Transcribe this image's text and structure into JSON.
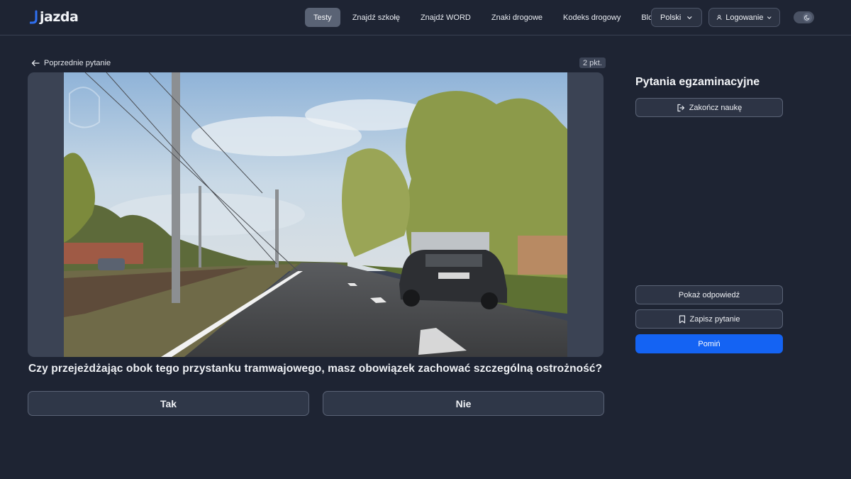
{
  "brand": {
    "name": "jazda"
  },
  "nav": {
    "items": [
      {
        "label": "Testy",
        "active": true
      },
      {
        "label": "Znajdź szkołę"
      },
      {
        "label": "Znajdź WORD"
      },
      {
        "label": "Znaki drogowe"
      },
      {
        "label": "Kodeks drogowy"
      },
      {
        "label": "Blog"
      }
    ],
    "language": "Polski",
    "login": "Logowanie",
    "theme_icon": "moon-icon"
  },
  "question_view": {
    "prev_label": "Poprzednie pytanie",
    "points": "2 pkt.",
    "question": "Czy przejeżdżając obok tego przystanku tramwajowego, masz obowiązek zachować szczególną ostrożność?",
    "answers": [
      "Tak",
      "Nie"
    ]
  },
  "sidebar": {
    "title": "Pytania egzaminacyjne",
    "finish_label": "Zakończ naukę",
    "show_answer_label": "Pokaż odpowiedź",
    "save_label": "Zapisz pytanie",
    "skip_label": "Pomiń"
  },
  "colors": {
    "background": "#1e2433",
    "accent": "#1463f3",
    "nav_active": "#5a6375"
  }
}
